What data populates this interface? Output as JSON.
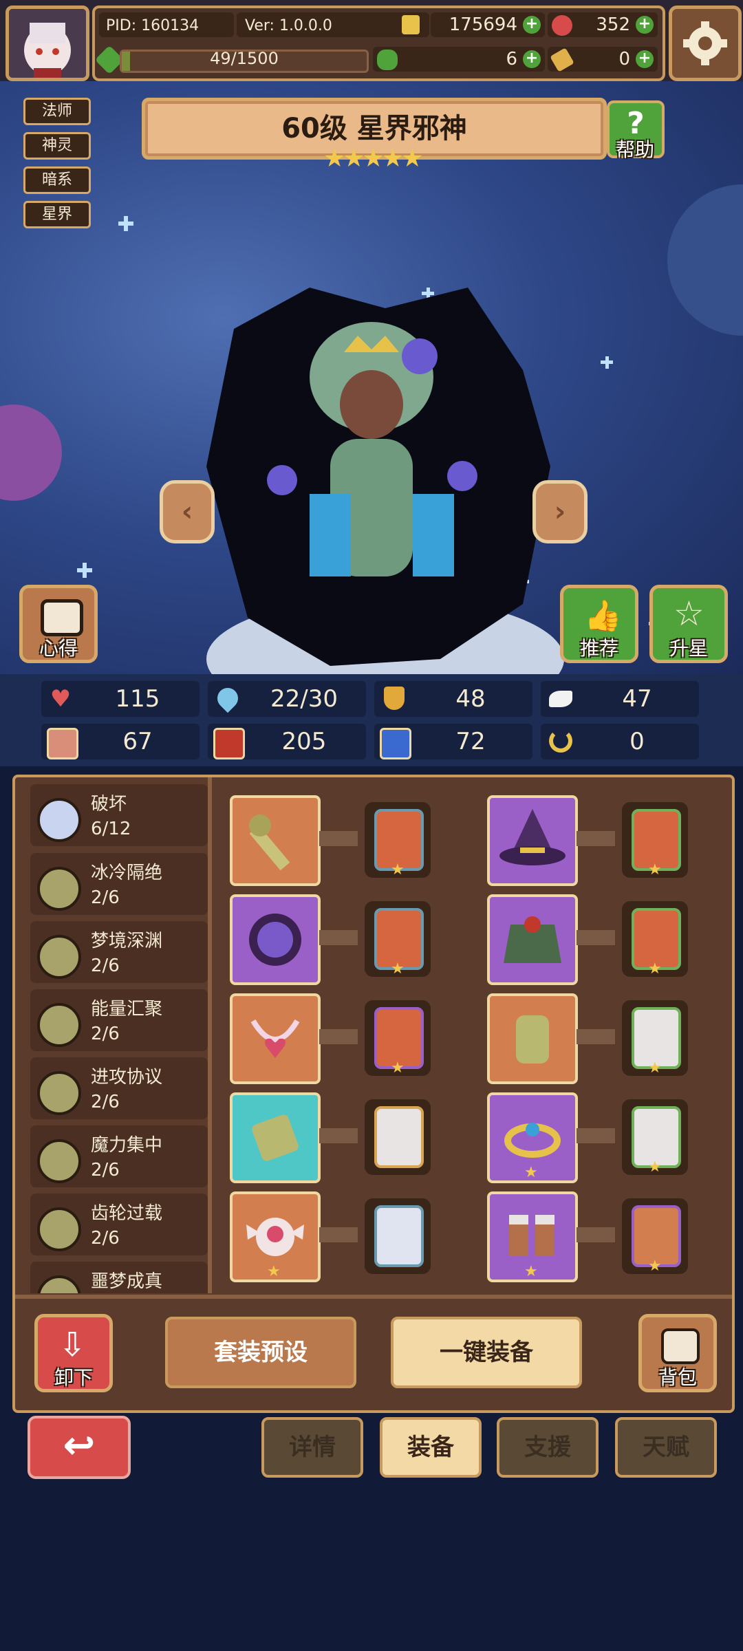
{
  "header": {
    "pid": "PID: 160134",
    "version": "Ver: 1.0.0.0",
    "gold": "175694",
    "gems": "352",
    "energy": "49/1500",
    "energy_fraction": 0.033,
    "clovers": "6",
    "keys": "0"
  },
  "tags": [
    "法师",
    "神灵",
    "暗系",
    "星界"
  ],
  "hero": {
    "title": "60级  星界邪神",
    "stars": "★★★★★",
    "help_label": "帮助",
    "notes_label": "心得",
    "recommend_label": "推荐",
    "starup_label": "升星"
  },
  "stats": {
    "hp": "115",
    "mana": "22/30",
    "defense": "48",
    "speed": "47",
    "attack": "67",
    "magic": "205",
    "boot": "72",
    "luck": "0"
  },
  "attributes": [
    {
      "name": "破坏",
      "value": "6/12"
    },
    {
      "name": "冰冷隔绝",
      "value": "2/6"
    },
    {
      "name": "梦境深渊",
      "value": "2/6"
    },
    {
      "name": "能量汇聚",
      "value": "2/6"
    },
    {
      "name": "进攻协议",
      "value": "2/6"
    },
    {
      "name": "魔力集中",
      "value": "2/6"
    },
    {
      "name": "齿轮过载",
      "value": "2/6"
    },
    {
      "name": "噩梦成真",
      "value": ""
    }
  ],
  "actions": {
    "unequip": "卸下",
    "preset": "套装预设",
    "auto_equip": "一键装备",
    "bag": "背包"
  },
  "nav": {
    "details": "详情",
    "equip": "装备",
    "support": "支援",
    "talent": "天赋"
  },
  "colors": {
    "accent_gold": "#c89a5d",
    "panel_brown": "#5b3b2b",
    "rarity_orange": "#d37e4f",
    "rarity_purple": "#9b5fc8",
    "rarity_cyan": "#4fc7c7"
  }
}
